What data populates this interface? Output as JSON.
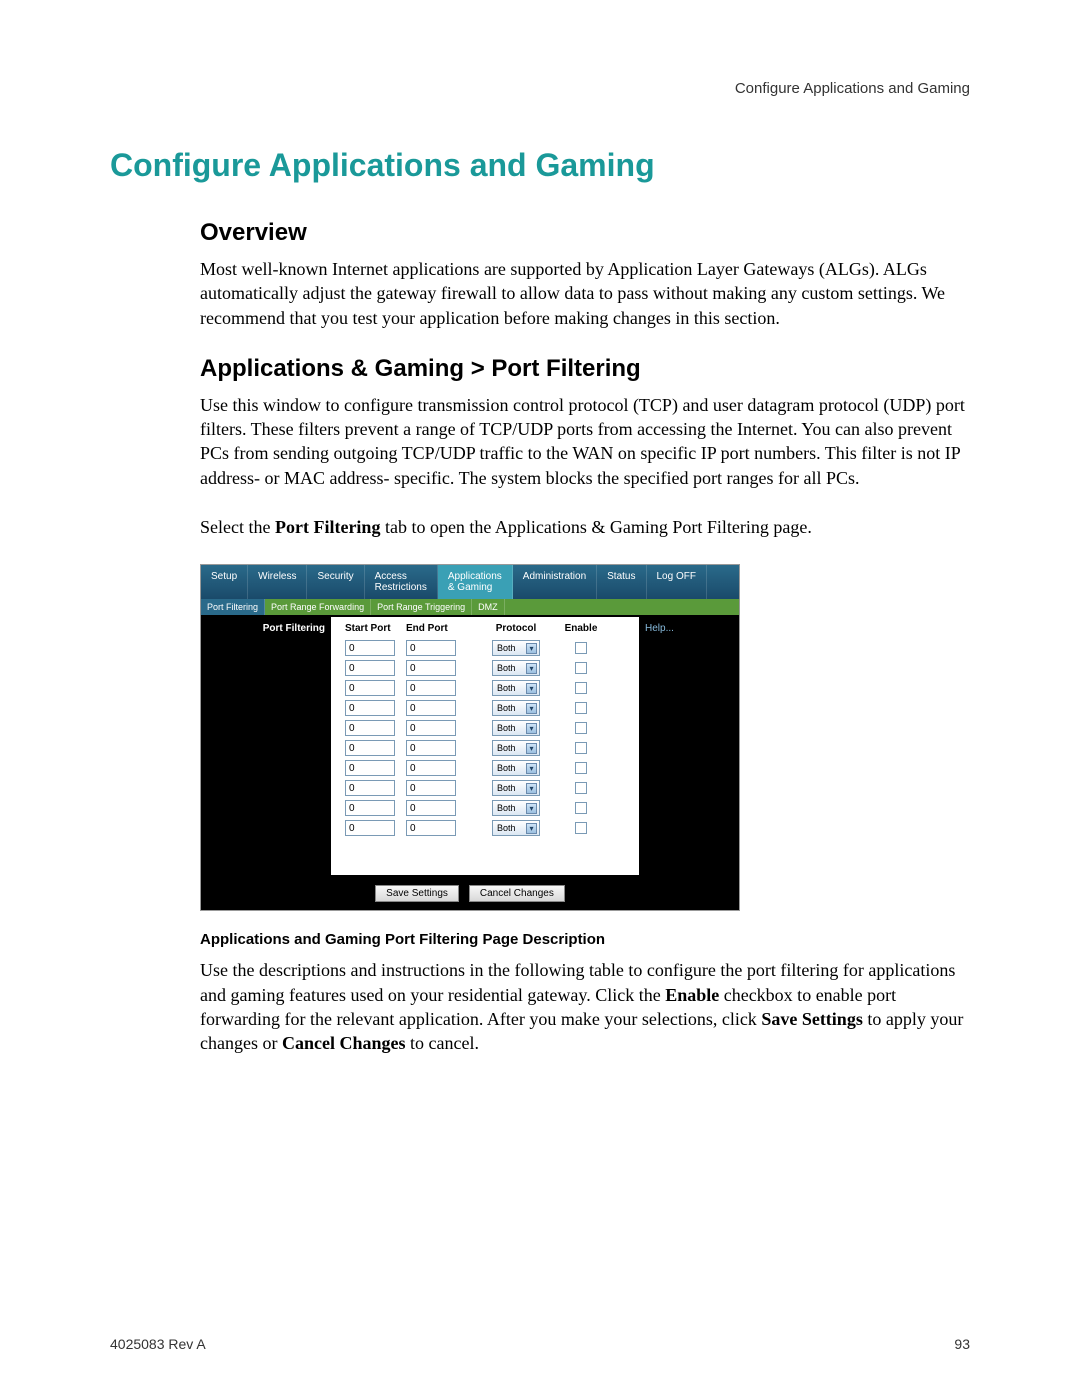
{
  "header": {
    "right_text": "Configure Applications and Gaming"
  },
  "title": "Configure Applications and Gaming",
  "sections": {
    "overview": {
      "heading": "Overview",
      "paragraph": "Most well-known Internet applications are supported by Application Layer Gateways (ALGs). ALGs automatically adjust the gateway firewall to allow data to pass without making any custom settings. We recommend that you test your application before making changes in this section."
    },
    "port_filtering": {
      "heading": "Applications & Gaming > Port Filtering",
      "paragraph1": "Use this window to configure transmission control protocol (TCP) and user datagram protocol (UDP) port filters. These filters prevent a range of TCP/UDP ports from accessing the Internet. You can also prevent PCs from sending outgoing TCP/UDP traffic to the WAN on specific IP port numbers. This filter is not IP address- or MAC address- specific. The system blocks the specified port ranges for all PCs.",
      "paragraph2_pre": "Select the ",
      "paragraph2_bold": "Port Filtering",
      "paragraph2_post": " tab to open the Applications & Gaming Port Filtering page."
    },
    "description": {
      "heading": "Applications and Gaming Port Filtering Page Description",
      "p1": "Use the descriptions and instructions in the following table to configure the port filtering for applications and gaming features used on your residential gateway. Click the ",
      "p1_b1": "Enable",
      "p1_mid": " checkbox to enable port forwarding for the relevant application. After you make your selections, click ",
      "p1_b2": "Save Settings",
      "p1_mid2": " to apply your changes or ",
      "p1_b3": "Cancel Changes",
      "p1_end": " to cancel."
    }
  },
  "ui": {
    "nav_tabs": [
      "Setup",
      "Wireless",
      "Security",
      "Access\nRestrictions",
      "Applications\n& Gaming",
      "Administration",
      "Status",
      "Log OFF"
    ],
    "nav_active_index": 4,
    "sub_tabs": [
      "Port Filtering",
      "Port Range Forwarding",
      "Port Range Triggering",
      "DMZ"
    ],
    "sub_active_index": 0,
    "side_label": "Port Filtering",
    "help_label": "Help...",
    "columns": {
      "start": "Start Port",
      "end": "End Port",
      "protocol": "Protocol",
      "enable": "Enable"
    },
    "rows": [
      {
        "start": "0",
        "end": "0",
        "protocol": "Both",
        "enable": false
      },
      {
        "start": "0",
        "end": "0",
        "protocol": "Both",
        "enable": false
      },
      {
        "start": "0",
        "end": "0",
        "protocol": "Both",
        "enable": false
      },
      {
        "start": "0",
        "end": "0",
        "protocol": "Both",
        "enable": false
      },
      {
        "start": "0",
        "end": "0",
        "protocol": "Both",
        "enable": false
      },
      {
        "start": "0",
        "end": "0",
        "protocol": "Both",
        "enable": false
      },
      {
        "start": "0",
        "end": "0",
        "protocol": "Both",
        "enable": false
      },
      {
        "start": "0",
        "end": "0",
        "protocol": "Both",
        "enable": false
      },
      {
        "start": "0",
        "end": "0",
        "protocol": "Both",
        "enable": false
      },
      {
        "start": "0",
        "end": "0",
        "protocol": "Both",
        "enable": false
      }
    ],
    "buttons": {
      "save": "Save Settings",
      "cancel": "Cancel Changes"
    }
  },
  "footer": {
    "left": "4025083 Rev A",
    "right": "93"
  }
}
